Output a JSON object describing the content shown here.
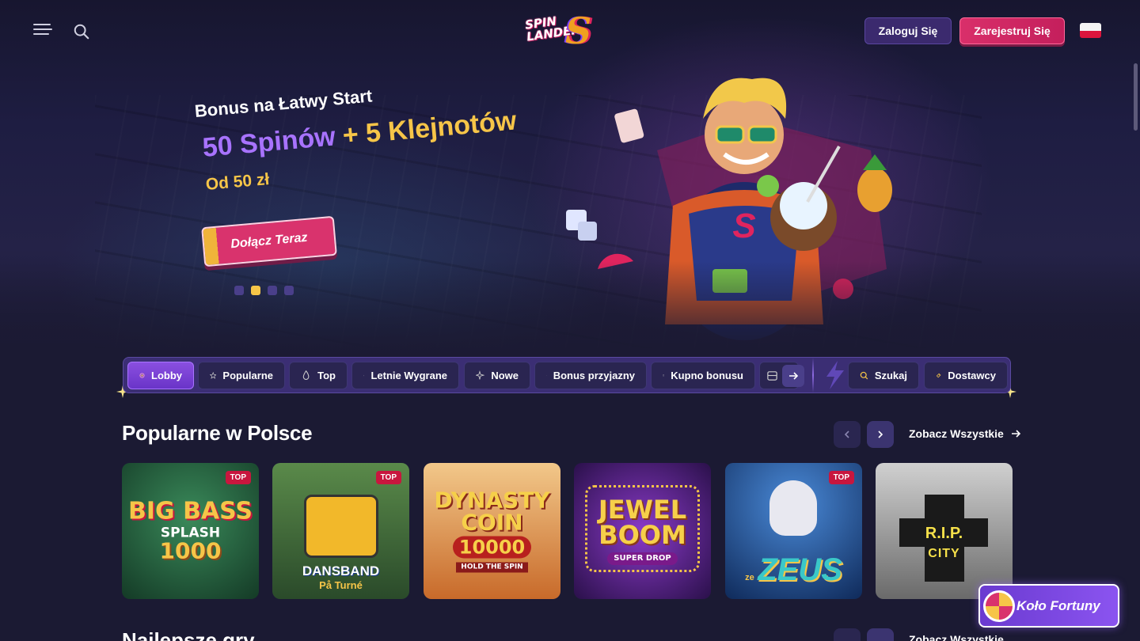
{
  "header": {
    "logo_line1": "SPIN",
    "logo_line2": "LANDER",
    "logo_s": "S",
    "login_label": "Zaloguj Się",
    "register_label": "Zarejestruj Się"
  },
  "hero": {
    "subtitle": "Bonus na Łatwy Start",
    "offer_part1": "50 Spinów",
    "offer_part2": "+ 5 Klejnotów",
    "min_deposit": "Od 50 zł",
    "cta_label": "Dołącz Teraz",
    "slides": 4,
    "active_slide": 2
  },
  "categories": {
    "items": [
      {
        "label": "Lobby",
        "icon": "lobby-icon"
      },
      {
        "label": "Popularne",
        "icon": "star-icon"
      },
      {
        "label": "Top",
        "icon": "flame-icon"
      },
      {
        "label": "Letnie Wygrane",
        "icon": "basket-icon"
      },
      {
        "label": "Nowe",
        "icon": "sparkle-icon"
      },
      {
        "label": "Bonus przyjazny",
        "icon": "coin-icon"
      },
      {
        "label": "Kupno bonusu",
        "icon": "jar-icon"
      }
    ],
    "search_label": "Szukaj",
    "providers_label": "Dostawcy"
  },
  "popular": {
    "title": "Popularne w Polsce",
    "see_all": "Zobacz Wszystkie",
    "games": [
      {
        "name": "BIG BASS",
        "line2": "SPLASH",
        "line3": "1000",
        "badge": "TOP",
        "bg": "#1f5a3a"
      },
      {
        "name": "DANSBAND",
        "line2": "På Turné",
        "line3": "",
        "badge": "TOP",
        "bg": "#3e6a2a"
      },
      {
        "name": "DYNASTY",
        "line2": "COIN",
        "line3": "10000",
        "line4": "HOLD THE SPIN",
        "badge": "",
        "bg": "#d98a3a"
      },
      {
        "name": "JEWEL",
        "line2": "BOOM",
        "line3": "SUPER DROP",
        "badge": "",
        "bg": "#4a1f8a"
      },
      {
        "name": "ZEUS",
        "line2": "ze",
        "line3": "",
        "badge": "TOP",
        "bg": "#1e4f8a"
      },
      {
        "name": "R.I.P.",
        "line2": "CITY",
        "line3": "",
        "badge": "",
        "bg": "#8a8a8a"
      }
    ]
  },
  "best": {
    "title": "Najlepsze gry",
    "see_all": "Zobacz Wszystkie"
  },
  "wheel": {
    "label": "Koło Fortuny"
  },
  "colors": {
    "accent_purple": "#8a4fe0",
    "accent_pink": "#d9336d",
    "accent_yellow": "#f6c548",
    "background": "#1b1a33"
  }
}
